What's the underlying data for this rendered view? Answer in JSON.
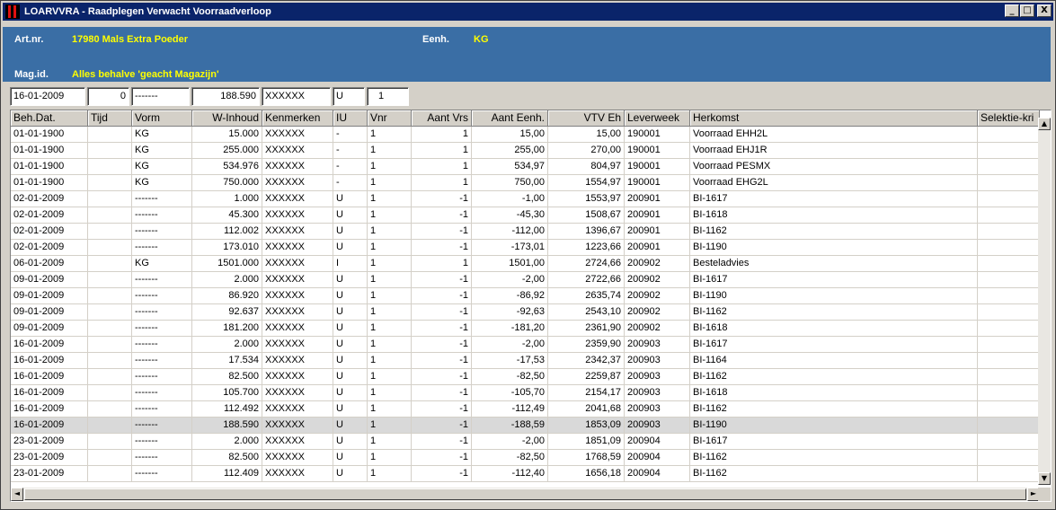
{
  "window": {
    "title": "LOARVVRA - Raadplegen Verwacht Voorraadverloop",
    "btn_min": "_",
    "btn_max": "□",
    "btn_close": "X"
  },
  "header": {
    "artnr_label": "Art.nr.",
    "artnr_value": "17980  Mals Extra Poeder",
    "eenh_label": "Eenh.",
    "eenh_value": "KG",
    "magid_label": "Mag.id.",
    "magid_value": "Alles behalve 'geacht Magazijn'"
  },
  "filters": [
    "16-01-2009",
    "0",
    "-------",
    "188.590",
    "XXXXXX",
    "U",
    "1"
  ],
  "columns": [
    "Beh.Dat.",
    "Tijd",
    "Vorm",
    "W-Inhoud",
    "Kenmerken",
    "IU",
    "Vnr",
    "Aant Vrs",
    "Aant Eenh.",
    "VTV Eh",
    "Leverweek",
    "Herkomst",
    "Selektie-kri"
  ],
  "rows": [
    [
      "01-01-1900",
      "",
      "KG",
      "15.000",
      "XXXXXX",
      "-",
      "1",
      "1",
      "15,00",
      "15,00",
      "190001",
      "Voorraad EHH2L",
      ""
    ],
    [
      "01-01-1900",
      "",
      "KG",
      "255.000",
      "XXXXXX",
      "-",
      "1",
      "1",
      "255,00",
      "270,00",
      "190001",
      "Voorraad EHJ1R",
      ""
    ],
    [
      "01-01-1900",
      "",
      "KG",
      "534.976",
      "XXXXXX",
      "-",
      "1",
      "1",
      "534,97",
      "804,97",
      "190001",
      "Voorraad PESMX",
      ""
    ],
    [
      "01-01-1900",
      "",
      "KG",
      "750.000",
      "XXXXXX",
      "-",
      "1",
      "1",
      "750,00",
      "1554,97",
      "190001",
      "Voorraad EHG2L",
      ""
    ],
    [
      "02-01-2009",
      "",
      "-------",
      "1.000",
      "XXXXXX",
      "U",
      "1",
      "-1",
      "-1,00",
      "1553,97",
      "200901",
      "BI-1617",
      ""
    ],
    [
      "02-01-2009",
      "",
      "-------",
      "45.300",
      "XXXXXX",
      "U",
      "1",
      "-1",
      "-45,30",
      "1508,67",
      "200901",
      "BI-1618",
      ""
    ],
    [
      "02-01-2009",
      "",
      "-------",
      "112.002",
      "XXXXXX",
      "U",
      "1",
      "-1",
      "-112,00",
      "1396,67",
      "200901",
      "BI-1162",
      ""
    ],
    [
      "02-01-2009",
      "",
      "-------",
      "173.010",
      "XXXXXX",
      "U",
      "1",
      "-1",
      "-173,01",
      "1223,66",
      "200901",
      "BI-1190",
      ""
    ],
    [
      "06-01-2009",
      "",
      "KG",
      "1501.000",
      "XXXXXX",
      "I",
      "1",
      "1",
      "1501,00",
      "2724,66",
      "200902",
      "Besteladvies",
      ""
    ],
    [
      "09-01-2009",
      "",
      "-------",
      "2.000",
      "XXXXXX",
      "U",
      "1",
      "-1",
      "-2,00",
      "2722,66",
      "200902",
      "BI-1617",
      ""
    ],
    [
      "09-01-2009",
      "",
      "-------",
      "86.920",
      "XXXXXX",
      "U",
      "1",
      "-1",
      "-86,92",
      "2635,74",
      "200902",
      "BI-1190",
      ""
    ],
    [
      "09-01-2009",
      "",
      "-------",
      "92.637",
      "XXXXXX",
      "U",
      "1",
      "-1",
      "-92,63",
      "2543,10",
      "200902",
      "BI-1162",
      ""
    ],
    [
      "09-01-2009",
      "",
      "-------",
      "181.200",
      "XXXXXX",
      "U",
      "1",
      "-1",
      "-181,20",
      "2361,90",
      "200902",
      "BI-1618",
      ""
    ],
    [
      "16-01-2009",
      "",
      "-------",
      "2.000",
      "XXXXXX",
      "U",
      "1",
      "-1",
      "-2,00",
      "2359,90",
      "200903",
      "BI-1617",
      ""
    ],
    [
      "16-01-2009",
      "",
      "-------",
      "17.534",
      "XXXXXX",
      "U",
      "1",
      "-1",
      "-17,53",
      "2342,37",
      "200903",
      "BI-1164",
      ""
    ],
    [
      "16-01-2009",
      "",
      "-------",
      "82.500",
      "XXXXXX",
      "U",
      "1",
      "-1",
      "-82,50",
      "2259,87",
      "200903",
      "BI-1162",
      ""
    ],
    [
      "16-01-2009",
      "",
      "-------",
      "105.700",
      "XXXXXX",
      "U",
      "1",
      "-1",
      "-105,70",
      "2154,17",
      "200903",
      "BI-1618",
      ""
    ],
    [
      "16-01-2009",
      "",
      "-------",
      "112.492",
      "XXXXXX",
      "U",
      "1",
      "-1",
      "-112,49",
      "2041,68",
      "200903",
      "BI-1162",
      ""
    ],
    [
      "16-01-2009",
      "",
      "-------",
      "188.590",
      "XXXXXX",
      "U",
      "1",
      "-1",
      "-188,59",
      "1853,09",
      "200903",
      "BI-1190",
      ""
    ],
    [
      "23-01-2009",
      "",
      "-------",
      "2.000",
      "XXXXXX",
      "U",
      "1",
      "-1",
      "-2,00",
      "1851,09",
      "200904",
      "BI-1617",
      ""
    ],
    [
      "23-01-2009",
      "",
      "-------",
      "82.500",
      "XXXXXX",
      "U",
      "1",
      "-1",
      "-82,50",
      "1768,59",
      "200904",
      "BI-1162",
      ""
    ],
    [
      "23-01-2009",
      "",
      "-------",
      "112.409",
      "XXXXXX",
      "U",
      "1",
      "-1",
      "-112,40",
      "1656,18",
      "200904",
      "BI-1162",
      ""
    ]
  ],
  "selected_row": 18,
  "scroll": {
    "up": "▲",
    "down": "▼",
    "left": "◄",
    "right": "►"
  },
  "colors": {
    "header_bg": "#3a6ea5",
    "header_value": "#ffff00",
    "title_bg": "#0a246a",
    "selected_row": "#d9d9d9"
  }
}
